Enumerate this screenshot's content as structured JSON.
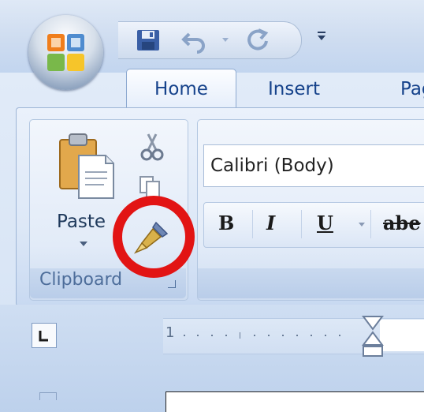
{
  "tabs": {
    "home": "Home",
    "insert": "Insert",
    "page_layout_partial": "Pag"
  },
  "clipboard": {
    "paste_label": "Paste",
    "group_label": "Clipboard"
  },
  "font": {
    "font_name": "Calibri (Body)",
    "bold_label": "B",
    "italic_label": "I",
    "underline_label": "U",
    "strikethrough_label": "abe"
  },
  "ruler": {
    "tick_number": "1"
  },
  "colors": {
    "highlight_circle": "#e21414",
    "tab_text": "#15428b",
    "ribbon_bg": "#dde8f7"
  },
  "icons": [
    "office-button-icon",
    "save-icon",
    "undo-icon",
    "redo-icon",
    "customize-qat-icon",
    "paste-icon",
    "cut-icon",
    "copy-icon",
    "format-painter-icon",
    "tab-selector-icon"
  ]
}
